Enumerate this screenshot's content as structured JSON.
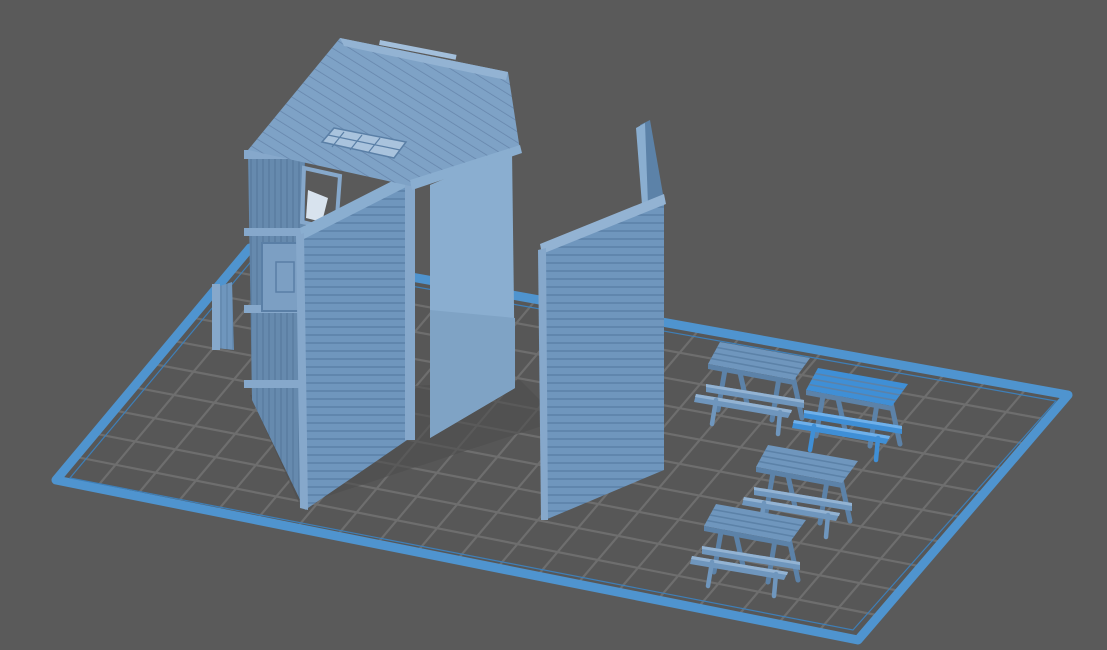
{
  "viewport": {
    "background": "#5a5a5a",
    "bed_outline_color": "#4f94cf",
    "grid_color": "#6e6e6e",
    "model_color": "#6f96bd",
    "model_shadow": "#5c82a8",
    "model_light": "#93b3d3",
    "selected_color": "#3f8fd6"
  },
  "scene": {
    "objects": [
      {
        "name": "storage-shed",
        "selected": false
      },
      {
        "name": "detached-wall-panel",
        "selected": false
      },
      {
        "name": "picnic-table",
        "selected": false
      },
      {
        "name": "picnic-table",
        "selected": true
      },
      {
        "name": "picnic-table",
        "selected": false
      },
      {
        "name": "picnic-table",
        "selected": false
      }
    ]
  }
}
